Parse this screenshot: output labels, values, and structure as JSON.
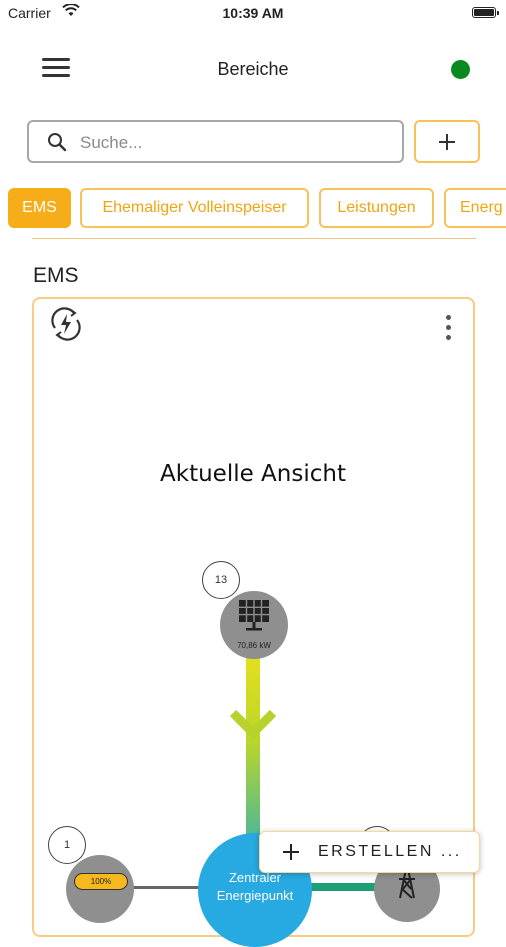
{
  "status_bar": {
    "carrier": "Carrier",
    "time": "10:39 AM"
  },
  "header": {
    "title": "Bereiche",
    "status_color": "#0a8a1e"
  },
  "search": {
    "placeholder": "Suche..."
  },
  "tabs": [
    {
      "label": "EMS",
      "active": true
    },
    {
      "label": "Ehemaliger Volleinspeiser",
      "active": false
    },
    {
      "label": "Leistungen",
      "active": false
    },
    {
      "label": "Energ",
      "active": false
    }
  ],
  "section": {
    "title": "EMS"
  },
  "card": {
    "heading": "Aktuelle Ansicht",
    "solar": {
      "count": "13",
      "value": "70,86 kW"
    },
    "battery": {
      "count": "1",
      "level": "100%"
    },
    "center": {
      "line1": "Zentraler",
      "line2": "Energiepunkt"
    }
  },
  "fab": {
    "label": "ERSTELLEN ..."
  },
  "colors": {
    "accent": "#f6ad19",
    "accent_border": "#f7c15c",
    "center_node": "#27a9e1",
    "node": "#8f8f8f"
  }
}
